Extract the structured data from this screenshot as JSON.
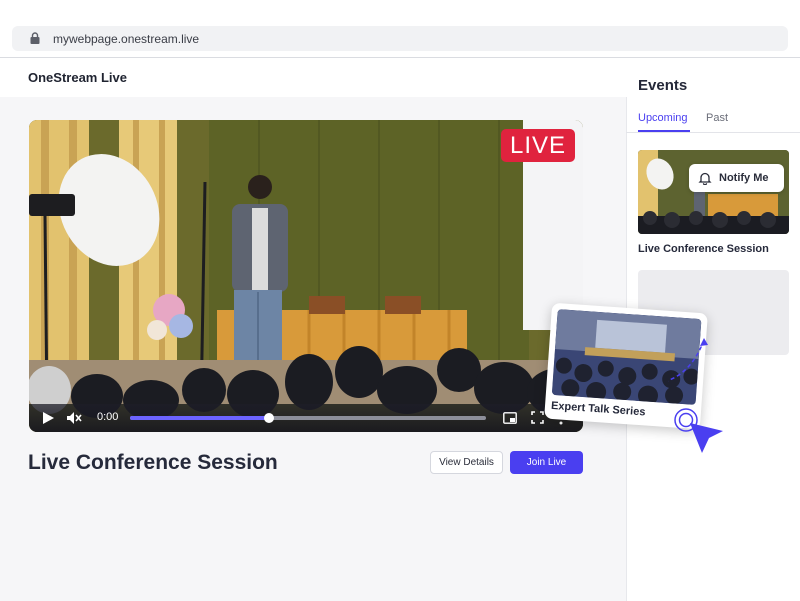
{
  "browser": {
    "url": "mywebpage.onestream.live"
  },
  "header": {
    "brand": "OneStream Live"
  },
  "player": {
    "live_badge": "LIVE",
    "time": "0:00",
    "progress": 0.39
  },
  "main": {
    "title": "Live Conference Session",
    "view_details_label": "View Details",
    "join_live_label": "Join Live"
  },
  "sidebar": {
    "title": "Events",
    "tabs": [
      {
        "label": "Upcoming",
        "active": true
      },
      {
        "label": "Past",
        "active": false
      }
    ],
    "events": [
      {
        "name": "Live Conference Session",
        "notify_label": "Notify Me"
      }
    ]
  },
  "floating_card": {
    "caption": "Expert Talk Series"
  },
  "colors": {
    "accent": "#4a3ff0",
    "live_red": "#e0233e",
    "progress_fill": "#6c63ff"
  }
}
